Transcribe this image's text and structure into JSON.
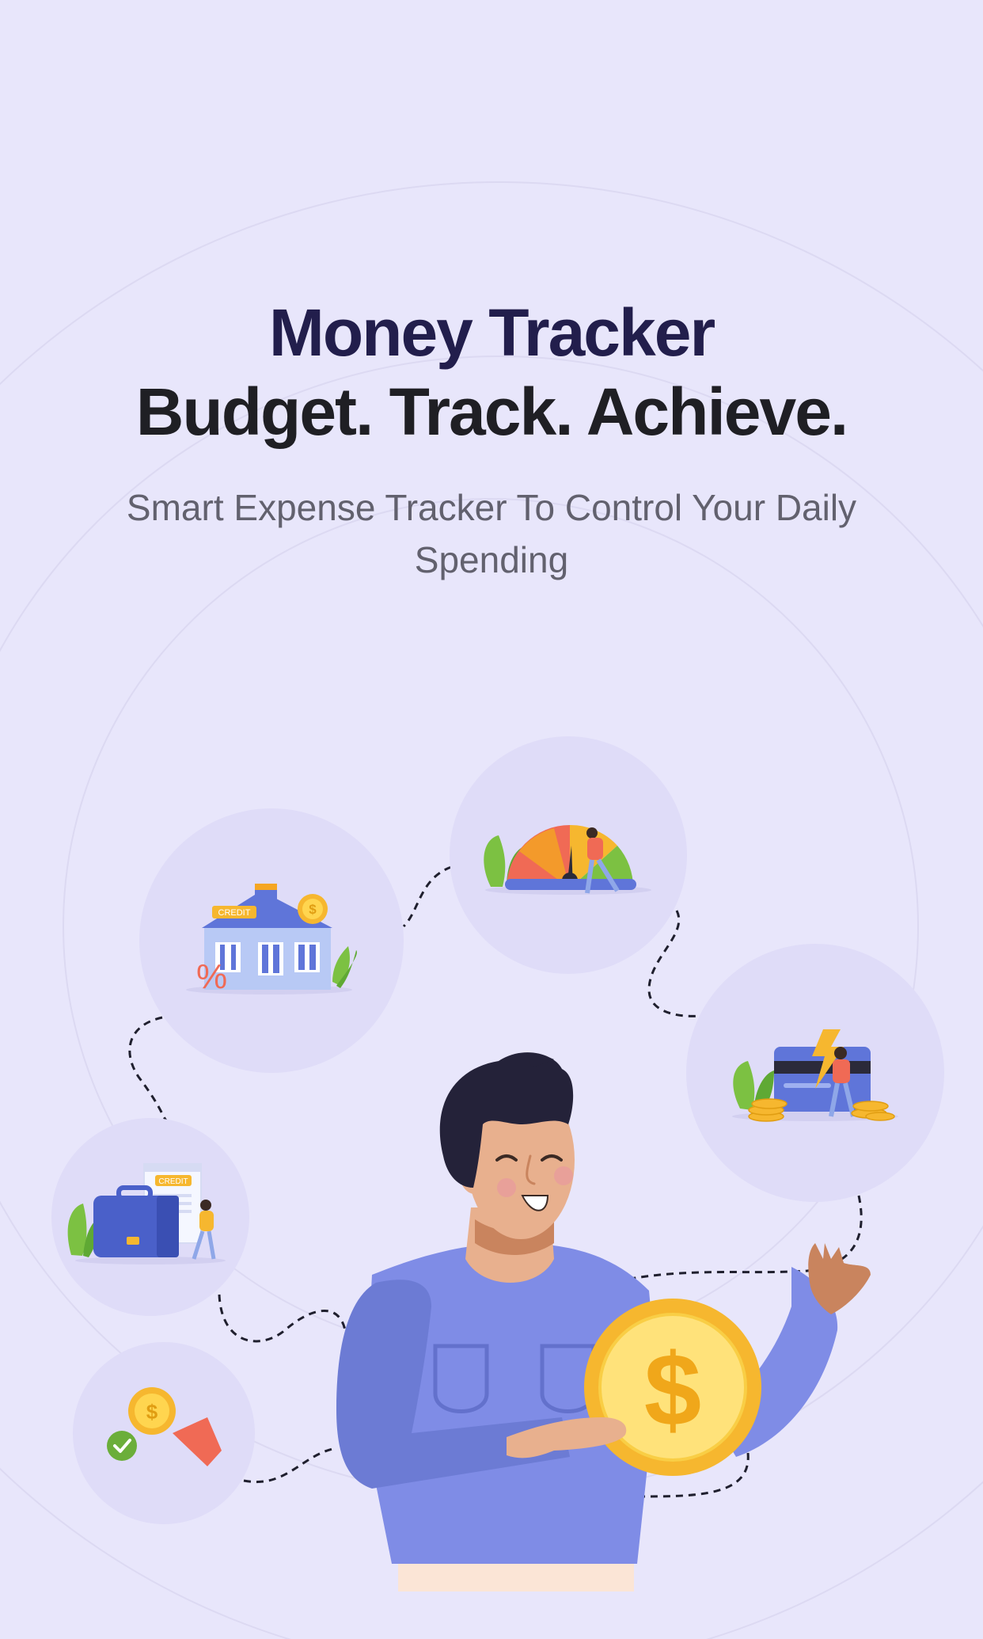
{
  "onboarding": {
    "title": "Money Tracker",
    "tagline": "Budget. Track. Achieve.",
    "subtitle": "Smart Expense Tracker To Control Your Daily Spending"
  },
  "illustrations": {
    "house_badge": "CREDIT",
    "house_percent": "%",
    "briefcase_badge": "CREDIT",
    "coin_symbol": "$"
  },
  "colors": {
    "background": "#E8E6FB",
    "bubble": "#DFDCF8",
    "title": "#221E4C",
    "accent_blue": "#7F8CE6",
    "coin_yellow": "#FBC02D"
  }
}
